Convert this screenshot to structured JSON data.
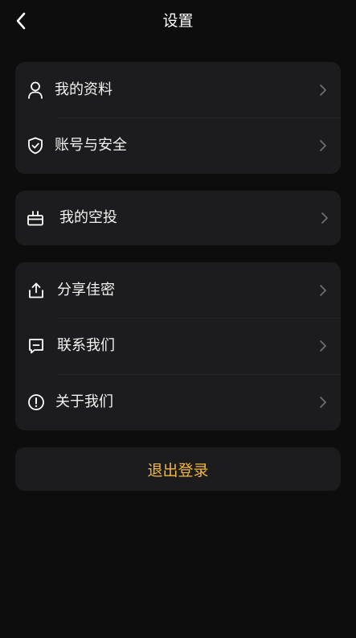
{
  "header": {
    "title": "设置",
    "back_icon": "chevron-left-icon"
  },
  "groups": [
    {
      "items": [
        {
          "label": "我的资料",
          "icon": "user-icon"
        },
        {
          "label": "账号与安全",
          "icon": "shield-check-icon"
        }
      ]
    },
    {
      "items": [
        {
          "label": "我的空投",
          "icon": "gift-icon"
        }
      ]
    },
    {
      "items": [
        {
          "label": "分享佳密",
          "icon": "share-icon"
        },
        {
          "label": "联系我们",
          "icon": "message-icon"
        },
        {
          "label": "关于我们",
          "icon": "info-icon"
        }
      ]
    }
  ],
  "logout": {
    "label": "退出登录"
  },
  "colors": {
    "background": "#0d0d0d",
    "card": "#1c1c1e",
    "text": "#f2f2f2",
    "chevron": "#6e6e73",
    "accent": "#f2b73c"
  }
}
